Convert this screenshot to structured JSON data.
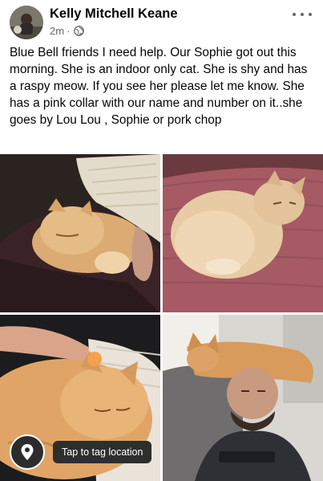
{
  "post": {
    "author": "Kelly Mitchell Keane",
    "time": "2m",
    "separator": "·",
    "privacy_icon": "globe-icon",
    "more_icon": "more-options-icon",
    "text": "Blue Bell friends I need help. Our Sophie got out this morning. She is an indoor only cat. She is shy and has a raspy meow. If you see her please let me know. She has a pink collar with our name and number on it..she goes by Lou Lou , Sophie or pork chop"
  },
  "photos": [
    {
      "icon": "cat-photo-1"
    },
    {
      "icon": "cat-photo-2"
    },
    {
      "icon": "cat-photo-3"
    },
    {
      "icon": "cat-photo-4"
    }
  ],
  "location": {
    "icon": "location-pin-icon",
    "tooltip": "Tap to tag location"
  }
}
